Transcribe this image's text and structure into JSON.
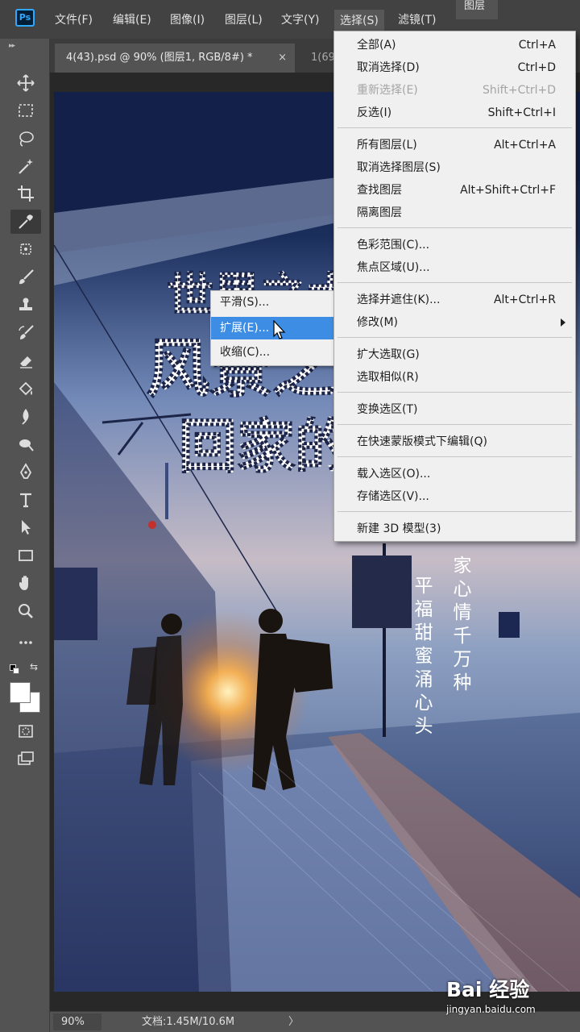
{
  "app": {
    "logo": "Ps"
  },
  "menubar": {
    "items": [
      "文件(F)",
      "编辑(E)",
      "图像(I)",
      "图层(L)",
      "文字(Y)",
      "选择(S)",
      "滤镜(T)"
    ],
    "active": "选择(S)"
  },
  "panels": {
    "layers_tab": "图层"
  },
  "tabs": [
    {
      "label": "4(43).psd @ 90% (图层1, RGB/8#) *",
      "active": true,
      "close": "×"
    },
    {
      "label": "1(69",
      "active": false
    }
  ],
  "tools": [
    "move-tool",
    "marquee-tool",
    "lasso-tool",
    "magic-wand-tool",
    "crop-tool",
    "eyedropper-tool",
    "healing-tool",
    "brush-tool",
    "stamp-tool",
    "history-brush-tool",
    "eraser-tool",
    "fill-tool",
    "blur-tool",
    "dodge-tool",
    "pen-tool",
    "type-tool",
    "path-select-tool",
    "shape-tool",
    "hand-tool",
    "zoom-tool",
    "more-tools"
  ],
  "select_menu": {
    "groups": [
      [
        {
          "label": "全部(A)",
          "shortcut": "Ctrl+A"
        },
        {
          "label": "取消选择(D)",
          "shortcut": "Ctrl+D"
        },
        {
          "label": "重新选择(E)",
          "shortcut": "Shift+Ctrl+D",
          "disabled": true
        },
        {
          "label": "反选(I)",
          "shortcut": "Shift+Ctrl+I"
        }
      ],
      [
        {
          "label": "所有图层(L)",
          "shortcut": "Alt+Ctrl+A"
        },
        {
          "label": "取消选择图层(S)",
          "shortcut": ""
        },
        {
          "label": "查找图层",
          "shortcut": "Alt+Shift+Ctrl+F"
        },
        {
          "label": "隔离图层",
          "shortcut": ""
        }
      ],
      [
        {
          "label": "色彩范围(C)...",
          "shortcut": ""
        },
        {
          "label": "焦点区域(U)...",
          "shortcut": ""
        }
      ],
      [
        {
          "label": "选择并遮住(K)...",
          "shortcut": "Alt+Ctrl+R"
        },
        {
          "label": "修改(M)",
          "shortcut": "",
          "submenu": true
        }
      ],
      [
        {
          "label": "扩大选取(G)",
          "shortcut": ""
        },
        {
          "label": "选取相似(R)",
          "shortcut": ""
        }
      ],
      [
        {
          "label": "变换选区(T)",
          "shortcut": ""
        }
      ],
      [
        {
          "label": "在快速蒙版模式下编辑(Q)",
          "shortcut": ""
        }
      ],
      [
        {
          "label": "载入选区(O)...",
          "shortcut": ""
        },
        {
          "label": "存储选区(V)...",
          "shortcut": ""
        }
      ],
      [
        {
          "label": "新建 3D 模型(3)",
          "shortcut": ""
        }
      ]
    ]
  },
  "modify_submenu": {
    "items": [
      "平滑(S)...",
      "扩展(E)...",
      "收缩(C)..."
    ],
    "highlighted": "扩展(E)..."
  },
  "poster": {
    "title_lines": [
      "世界之大",
      "风景之美",
      "回家的路"
    ],
    "vertical_lines": [
      "平福甜蜜涌心头",
      "家心情千万种"
    ]
  },
  "status": {
    "zoom": "90%",
    "doc_info": "文档:1.45M/10.6M",
    "arrow": "〉"
  },
  "watermark": {
    "logo": "Bai 经验",
    "url": "jingyan.baidu.com"
  },
  "colors": {
    "menu_bg": "#f0f0f0",
    "highlight": "#3c8de3",
    "chrome": "#535353",
    "menubar": "#424242"
  }
}
